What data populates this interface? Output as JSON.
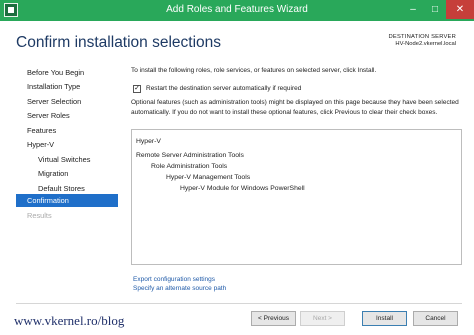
{
  "window": {
    "title": "Add Roles and Features Wizard",
    "controls": {
      "minimize": "–",
      "maximize": "□",
      "close": "✕"
    }
  },
  "header": {
    "title": "Confirm installation selections",
    "destination_label": "DESTINATION SERVER",
    "destination_value": "HV-Node2.vkernel.local"
  },
  "nav": {
    "items": [
      {
        "label": "Before You Begin",
        "state": "normal"
      },
      {
        "label": "Installation Type",
        "state": "normal"
      },
      {
        "label": "Server Selection",
        "state": "normal"
      },
      {
        "label": "Server Roles",
        "state": "normal"
      },
      {
        "label": "Features",
        "state": "normal"
      },
      {
        "label": "Hyper-V",
        "state": "normal"
      },
      {
        "label": "Virtual Switches",
        "state": "normal"
      },
      {
        "label": "Migration",
        "state": "normal"
      },
      {
        "label": "Default Stores",
        "state": "normal"
      },
      {
        "label": "Confirmation",
        "state": "active"
      },
      {
        "label": "Results",
        "state": "disabled"
      }
    ]
  },
  "content": {
    "intro": "To install the following roles, role services, or features on selected server, click Install.",
    "restart_checked": "✓",
    "restart_label": "Restart the destination server automatically if required",
    "note": "Optional features (such as administration tools) might be displayed on this page because they have been selected automatically. If you do not want to install these optional features, click Previous to clear their check boxes.",
    "features": [
      "Hyper-V",
      "Remote Server Administration Tools",
      "Role Administration Tools",
      "Hyper-V Management Tools",
      "Hyper-V Module for Windows PowerShell"
    ],
    "links": {
      "export": "Export configuration settings",
      "alternate": "Specify an alternate source path"
    }
  },
  "footer": {
    "watermark": "www.vkernel.ro/blog",
    "previous": "< Previous",
    "next": "Next >",
    "install": "Install",
    "cancel": "Cancel"
  },
  "colors": {
    "titlebar": "#29a85a",
    "close": "#c63f3a",
    "nav_active": "#1f6fc9",
    "title_text": "#1e3a64",
    "link": "#1f5aa8"
  }
}
